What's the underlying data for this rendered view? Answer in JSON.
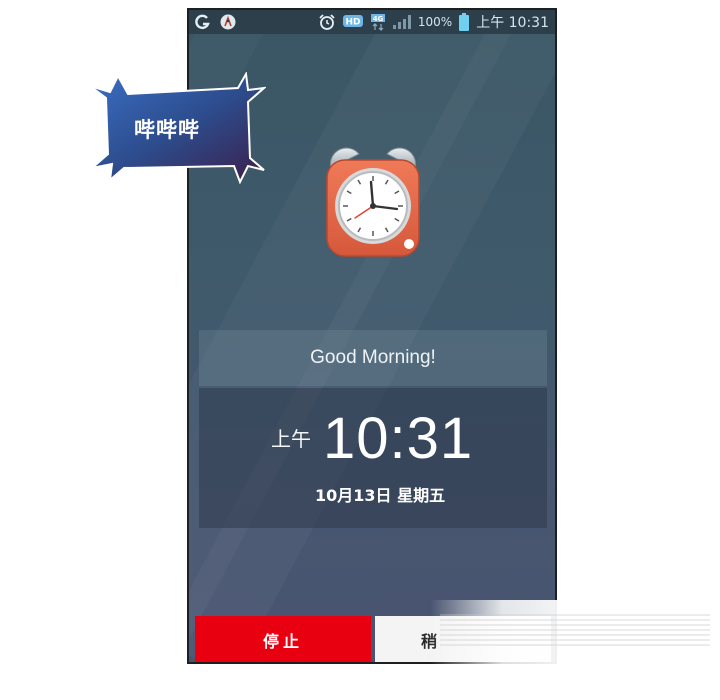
{
  "status_bar": {
    "battery_text": "100%",
    "time": "上午 10:31",
    "left_icons": [
      "carrier-g-icon",
      "app-notification-icon"
    ],
    "right_icons": [
      "alarm-clock-icon",
      "hd-voice-icon",
      "4g-network-icon",
      "signal-strength-icon",
      "battery-icon"
    ]
  },
  "alarm": {
    "greeting": "Good Morning!",
    "ampm": "上午",
    "time": "10:31",
    "date": "10月13日 星期五"
  },
  "buttons": {
    "stop_label": "停止",
    "snooze_label": "稍"
  },
  "sticker": {
    "text": "哔哔哔"
  },
  "colors": {
    "stop_button": "#e80011",
    "snooze_button": "#f4f4f4",
    "background_top": "#3a5664",
    "background_bottom": "#4a5471",
    "clock_body": "#e2684a",
    "sticker_fill": "#2f4f8f"
  }
}
